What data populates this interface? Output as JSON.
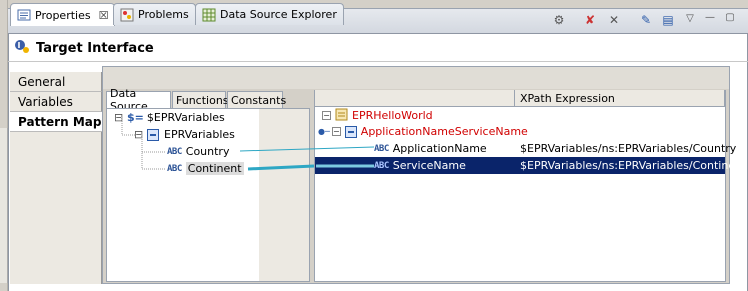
{
  "tabs": [
    {
      "label": "Properties",
      "active": true,
      "icon": "properties-icon",
      "close": "☒"
    },
    {
      "label": "Problems",
      "active": false,
      "icon": "problems-icon"
    },
    {
      "label": "Data Source Explorer",
      "active": false,
      "icon": "datasource-icon"
    }
  ],
  "toolbar": {
    "icons": [
      "filter-icon",
      "delete-icon",
      "remove-icon",
      "edit-icon",
      "table-icon",
      "view-menu-icon",
      "minimize-icon",
      "maximize-icon"
    ],
    "glyphs": [
      "⚙",
      "✘",
      "✕",
      "✎",
      "▤",
      "▽",
      "—",
      "▢"
    ]
  },
  "header": {
    "title": "Target Interface",
    "icon": "interface-icon"
  },
  "categories": [
    {
      "label": "General",
      "active": false
    },
    {
      "label": "Variables",
      "active": false
    },
    {
      "label": "Pattern Map",
      "active": true
    }
  ],
  "subtabs": [
    {
      "label": "Data Source",
      "active": true
    },
    {
      "label": "Functions",
      "active": false
    },
    {
      "label": "Constants",
      "active": false
    }
  ],
  "source_tree": {
    "root": {
      "label": "$EPRVariables",
      "expander": "⊟"
    },
    "group": {
      "label": "EPRVariables",
      "expander": "⊟"
    },
    "fields": [
      {
        "label": "Country",
        "type_badge": "ABC"
      },
      {
        "label": "Continent",
        "type_badge": "ABC"
      }
    ]
  },
  "target_table": {
    "columns": [
      "",
      "XPath Expression"
    ],
    "rows": [
      {
        "label": "EPRHelloWorld",
        "xpath": "",
        "level": 0
      },
      {
        "label": "ApplicationNameServiceName",
        "xpath": "",
        "level": 1
      },
      {
        "label": "ApplicationName",
        "xpath": "$EPRVariables/ns:EPRVariables/Country",
        "level": 2,
        "badge": "ABC"
      },
      {
        "label": "ServiceName",
        "xpath": "$EPRVariables/ns:EPRVariables/Continent",
        "level": 2,
        "badge": "ABC",
        "selected": true
      }
    ]
  },
  "colors": {
    "selection": "#0a246a",
    "mapping_line": "#2ea7c4",
    "error_text": "#d00000",
    "badge_text": "#2f5597"
  }
}
